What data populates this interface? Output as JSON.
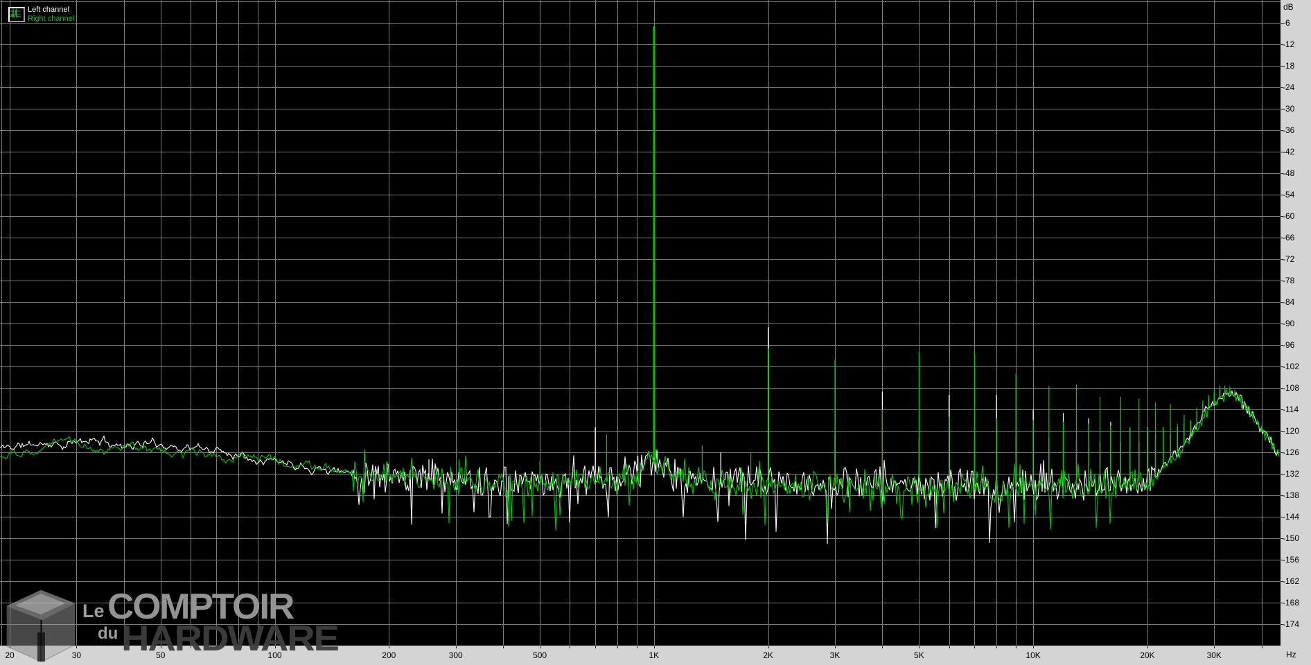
{
  "legend": {
    "items": [
      {
        "label": "Left channel",
        "color": "#ffffff"
      },
      {
        "label": "Right channel",
        "color": "#00c800"
      }
    ]
  },
  "axes": {
    "y_unit_label": "dB",
    "x_unit_label": "Hz",
    "y_tick_labels": [
      "-6",
      "-12",
      "-18",
      "-24",
      "-30",
      "-36",
      "-42",
      "-48",
      "-54",
      "-60",
      "-66",
      "-72",
      "-78",
      "-84",
      "-90",
      "-96",
      "-102",
      "-108",
      "-114",
      "-120",
      "-126",
      "-132",
      "-138",
      "-144",
      "-150",
      "-156",
      "-162",
      "-168",
      "-174"
    ],
    "x_ticks": [
      {
        "f": 20,
        "label": "20"
      },
      {
        "f": 30,
        "label": "30"
      },
      {
        "f": 50,
        "label": "50"
      },
      {
        "f": 100,
        "label": "100"
      },
      {
        "f": 200,
        "label": "200"
      },
      {
        "f": 300,
        "label": "300"
      },
      {
        "f": 500,
        "label": "500"
      },
      {
        "f": 1000,
        "label": "1K"
      },
      {
        "f": 2000,
        "label": "2K"
      },
      {
        "f": 3000,
        "label": "3K"
      },
      {
        "f": 5000,
        "label": "5K"
      },
      {
        "f": 10000,
        "label": "10K"
      },
      {
        "f": 20000,
        "label": "20K"
      },
      {
        "f": 30000,
        "label": "30K"
      }
    ]
  },
  "watermark": {
    "le": "Le",
    "comptoir": "COMPTOIR",
    "du": "du",
    "hardware": "HARDWARE"
  },
  "colors": {
    "background": "#000000",
    "grid": "#7c7c7c",
    "axis_strip": "#d4d4d4",
    "left_channel": "#ffffff",
    "right_channel": "#00c800"
  },
  "chart_data": {
    "type": "line",
    "title": "Audio spectrum analysis (FFT), left vs right channel, 1 kHz test tone",
    "xlabel": "Hz",
    "ylabel": "dB",
    "x_scale": "log",
    "x_range_hz": [
      19,
      44900
    ],
    "y_range_db": [
      -180,
      0
    ],
    "y_grid_step_db": 6,
    "grid": true,
    "legend_position": "top-left",
    "series": [
      {
        "name": "Left channel",
        "color": "#ffffff",
        "floor_envelope": [
          [
            18,
            -125
          ],
          [
            24,
            -123.5
          ],
          [
            28,
            -124
          ],
          [
            33,
            -122.5
          ],
          [
            40,
            -124
          ],
          [
            48,
            -123.5
          ],
          [
            55,
            -124.5
          ],
          [
            65,
            -125
          ],
          [
            75,
            -126
          ],
          [
            90,
            -127.5
          ],
          [
            110,
            -129
          ],
          [
            140,
            -131
          ],
          [
            180,
            -132.5
          ],
          [
            250,
            -133.5
          ],
          [
            350,
            -134
          ],
          [
            500,
            -134.5
          ],
          [
            700,
            -134
          ],
          [
            850,
            -133
          ],
          [
            930,
            -130.5
          ],
          [
            1000,
            -128.5
          ],
          [
            1070,
            -130.5
          ],
          [
            1150,
            -133
          ],
          [
            1400,
            -134
          ],
          [
            2000,
            -134.5
          ],
          [
            3000,
            -135
          ],
          [
            5000,
            -135.5
          ],
          [
            8000,
            -135.5
          ],
          [
            12000,
            -135.5
          ],
          [
            16000,
            -135
          ],
          [
            20000,
            -134
          ],
          [
            21500,
            -131
          ],
          [
            23000,
            -128
          ],
          [
            24500,
            -125
          ],
          [
            26000,
            -121.5
          ],
          [
            27500,
            -117.5
          ],
          [
            29000,
            -113.5
          ],
          [
            30500,
            -111
          ],
          [
            32000,
            -109.7
          ],
          [
            33000,
            -109.4
          ],
          [
            34500,
            -110.5
          ],
          [
            36000,
            -112.5
          ],
          [
            38000,
            -116
          ],
          [
            40000,
            -119.5
          ],
          [
            42000,
            -122.5
          ],
          [
            44000,
            -126
          ],
          [
            44900,
            -127.5
          ]
        ],
        "spikes": [
          [
            255,
            -128
          ],
          [
            700,
            -119
          ],
          [
            907,
            -127
          ],
          [
            1500,
            -126
          ],
          [
            2000,
            -91
          ],
          [
            3000,
            -121
          ],
          [
            4000,
            -109
          ],
          [
            5000,
            -122
          ],
          [
            6000,
            -110
          ],
          [
            7000,
            -122
          ],
          [
            8000,
            -110
          ],
          [
            9000,
            -121
          ],
          [
            10000,
            -114
          ],
          [
            11000,
            -122
          ],
          [
            12000,
            -115
          ],
          [
            13000,
            -122.5
          ],
          [
            14000,
            -116.5
          ],
          [
            15000,
            -123
          ],
          [
            16000,
            -117.5
          ],
          [
            17000,
            -123
          ],
          [
            18000,
            -119
          ],
          [
            19000,
            -123
          ],
          [
            20000,
            -120
          ],
          [
            21000,
            -121
          ],
          [
            22000,
            -119
          ],
          [
            23000,
            -121
          ],
          [
            24000,
            -119
          ],
          [
            25000,
            -118
          ],
          [
            26000,
            -117
          ],
          [
            27000,
            -114.5
          ],
          [
            28000,
            -112.5
          ],
          [
            29000,
            -111
          ],
          [
            30000,
            -109.5
          ],
          [
            31000,
            -108.5
          ],
          [
            32000,
            -108
          ],
          [
            33000,
            -108.3
          ],
          [
            34000,
            -109.3
          ],
          [
            35000,
            -110.8
          ]
        ]
      },
      {
        "name": "Right channel",
        "color": "#00c800",
        "fundamental": [
          1000,
          -6.9
        ],
        "floor_envelope": [
          [
            18,
            -126.5
          ],
          [
            24,
            -125.5
          ],
          [
            27,
            -122
          ],
          [
            31,
            -124
          ],
          [
            36,
            -126
          ],
          [
            42,
            -124.5
          ],
          [
            50,
            -125.5
          ],
          [
            60,
            -126
          ],
          [
            70,
            -127
          ],
          [
            85,
            -127.5
          ],
          [
            105,
            -128.5
          ],
          [
            135,
            -130.5
          ],
          [
            175,
            -132
          ],
          [
            240,
            -133.5
          ],
          [
            340,
            -134.5
          ],
          [
            480,
            -135
          ],
          [
            650,
            -134.5
          ],
          [
            820,
            -133.5
          ],
          [
            920,
            -130.5
          ],
          [
            1000,
            -127.5
          ],
          [
            1080,
            -130.5
          ],
          [
            1160,
            -133
          ],
          [
            1400,
            -134.5
          ],
          [
            2000,
            -135
          ],
          [
            3000,
            -135.5
          ],
          [
            5000,
            -136
          ],
          [
            8000,
            -136
          ],
          [
            12000,
            -136
          ],
          [
            16000,
            -135.5
          ],
          [
            20000,
            -134.5
          ],
          [
            21500,
            -131.5
          ],
          [
            23000,
            -128.5
          ],
          [
            24500,
            -125.5
          ],
          [
            26000,
            -122
          ],
          [
            27500,
            -118
          ],
          [
            29000,
            -114
          ],
          [
            30500,
            -111.3
          ],
          [
            32000,
            -110
          ],
          [
            33000,
            -109.7
          ],
          [
            34500,
            -110.8
          ],
          [
            36000,
            -112.8
          ],
          [
            38000,
            -116.3
          ],
          [
            40000,
            -119.8
          ],
          [
            42000,
            -122.8
          ],
          [
            44000,
            -126.3
          ],
          [
            44900,
            -128
          ]
        ],
        "spikes": [
          [
            306,
            -128
          ],
          [
            500,
            -128.5
          ],
          [
            750,
            -121
          ],
          [
            1340,
            -124
          ],
          [
            1800,
            -126
          ],
          [
            2000,
            -97
          ],
          [
            3000,
            -100
          ],
          [
            4000,
            -114
          ],
          [
            5000,
            -98
          ],
          [
            6000,
            -116
          ],
          [
            7000,
            -98
          ],
          [
            8000,
            -116.5
          ],
          [
            9000,
            -104
          ],
          [
            10000,
            -117
          ],
          [
            11000,
            -107.5
          ],
          [
            12000,
            -117.5
          ],
          [
            13000,
            -107
          ],
          [
            14000,
            -118
          ],
          [
            15000,
            -110.5
          ],
          [
            16000,
            -118.5
          ],
          [
            17000,
            -110.5
          ],
          [
            18000,
            -119
          ],
          [
            19000,
            -111
          ],
          [
            20000,
            -119
          ],
          [
            21000,
            -112
          ],
          [
            22000,
            -119
          ],
          [
            23000,
            -112.5
          ],
          [
            24000,
            -118
          ],
          [
            25000,
            -115.5
          ],
          [
            26000,
            -117
          ],
          [
            27000,
            -113.5
          ],
          [
            28000,
            -111.5
          ],
          [
            29000,
            -110
          ],
          [
            30000,
            -108.5
          ],
          [
            31000,
            -107.5
          ],
          [
            32000,
            -107.3
          ],
          [
            33000,
            -107.5
          ],
          [
            34000,
            -108.5
          ],
          [
            35000,
            -110
          ],
          [
            36000,
            -111.5
          ],
          [
            37000,
            -113
          ],
          [
            38000,
            -115
          ],
          [
            39000,
            -117
          ],
          [
            40000,
            -118.5
          ],
          [
            41000,
            -120
          ],
          [
            42000,
            -121.5
          ],
          [
            43000,
            -123.5
          ]
        ]
      }
    ]
  }
}
